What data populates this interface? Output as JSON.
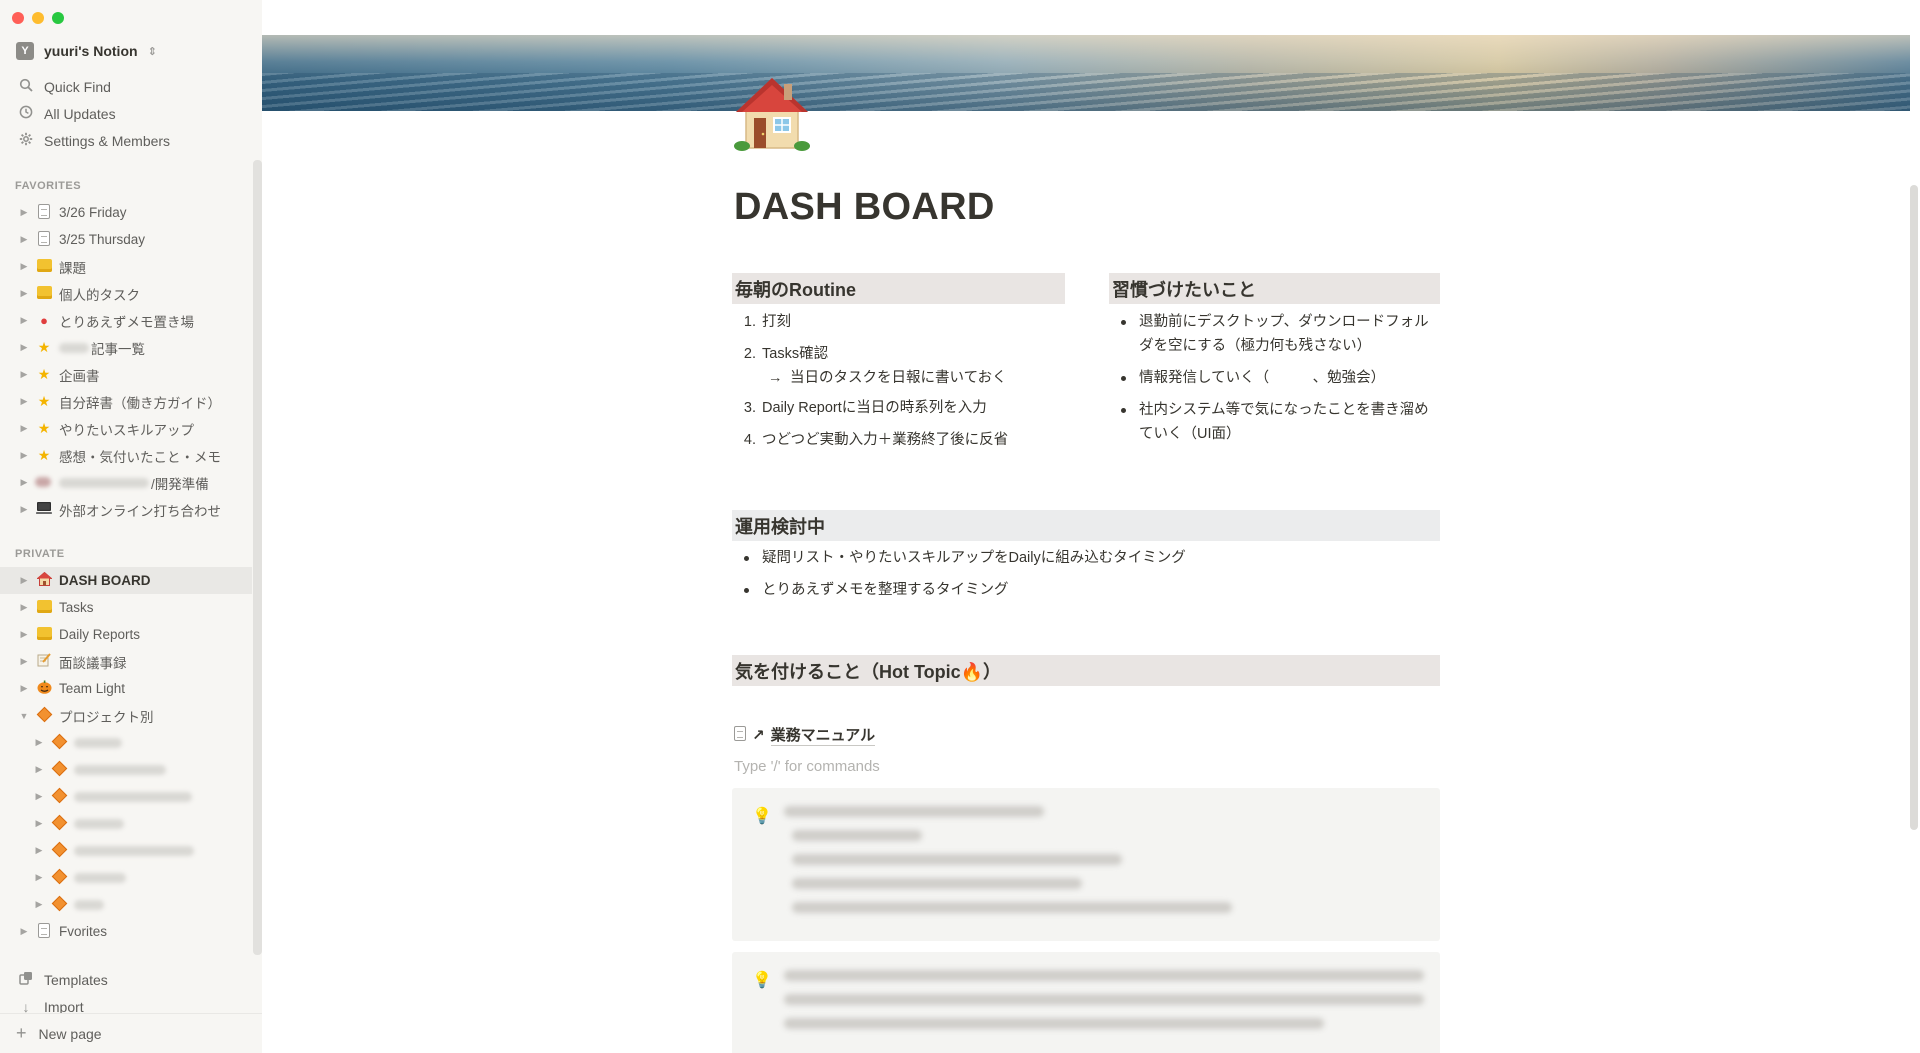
{
  "workspace": {
    "badge": "Y",
    "name": "yuuri's Notion"
  },
  "topnav": [
    {
      "label": "Quick Find",
      "icon": "search-icon"
    },
    {
      "label": "All Updates",
      "icon": "clock-icon"
    },
    {
      "label": "Settings & Members",
      "icon": "gear-icon"
    }
  ],
  "favorites_label": "FAVORITES",
  "favorites": [
    "3/26 Friday",
    "3/25 Thursday",
    "課題",
    "個人的タスク",
    "とりあえずメモ置き場",
    "記事一覧",
    "企画書",
    "自分辞書（働き方ガイド）",
    "やりたいスキルアップ",
    "感想・気付いたこと・メモ",
    "/開発準備",
    "外部オンライン打ち合わせ"
  ],
  "private_label": "PRIVATE",
  "private": [
    "DASH BOARD",
    "Tasks",
    "Daily Reports",
    "面談議事録",
    "Team Light",
    "プロジェクト別",
    "Fvorites"
  ],
  "bottom": {
    "templates": "Templates",
    "import": "Import",
    "new_page": "New page"
  },
  "page": {
    "title": "DASH BOARD",
    "routine": {
      "heading": "毎朝のRoutine",
      "items": [
        {
          "n": "1.",
          "text": "打刻"
        },
        {
          "n": "2.",
          "text": "Tasks確認"
        },
        {
          "n": "3.",
          "text": "Daily Reportに当日の時系列を入力"
        },
        {
          "n": "4.",
          "text": "つどつど実動入力＋業務終了後に反省"
        }
      ],
      "sub_arrow": "→",
      "sub_text": "当日のタスクを日報に書いておく"
    },
    "habits": {
      "heading": "習慣づけたいこと",
      "items": [
        "退勤前にデスクトップ、ダウンロードフォルダを空にする（極力何も残さない）",
        "情報発信していく（　　　、勉強会）",
        "社内システム等で気になったことを書き溜めていく（UI面）"
      ]
    },
    "considering": {
      "heading": "運用検討中",
      "items": [
        "疑問リスト・やりたいスキルアップをDailyに組み込むタイミング",
        "とりあえずメモを整理するタイミング"
      ]
    },
    "hot_topic": {
      "heading": "気を付けること（Hot Topic🔥）"
    },
    "link": {
      "arrow": "↗",
      "label": "業務マニュアル"
    },
    "placeholder": "Type '/' for commands"
  }
}
